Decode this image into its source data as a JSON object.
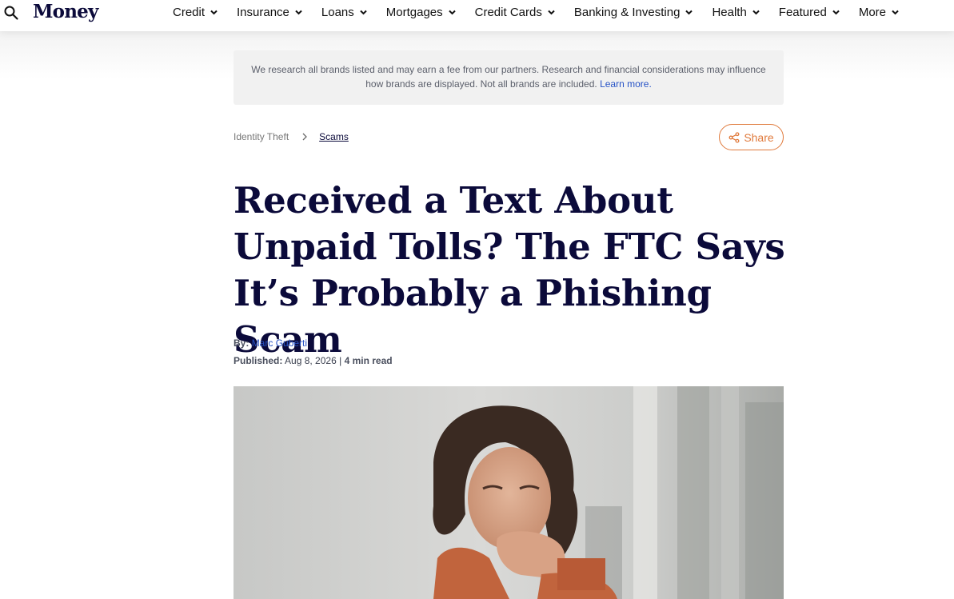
{
  "header": {
    "logo": "Money",
    "nav": [
      {
        "label": "Credit"
      },
      {
        "label": "Insurance"
      },
      {
        "label": "Loans"
      },
      {
        "label": "Mortgages"
      },
      {
        "label": "Credit Cards"
      },
      {
        "label": "Banking & Investing"
      },
      {
        "label": "Health"
      },
      {
        "label": "Featured"
      },
      {
        "label": "More"
      }
    ]
  },
  "disclosure": {
    "text": "We research all brands listed and may earn a fee from our partners. Research and financial considerations may influence how brands are displayed. Not all brands are included.",
    "link": "Learn more."
  },
  "breadcrumb": {
    "parent": "Identity Theft",
    "current": "Scams"
  },
  "share": {
    "label": "Share"
  },
  "article": {
    "title": "Received a Text About Unpaid Tolls? The FTC Says It’s Probably a Phishing Scam",
    "by_label": "By:",
    "author": "Marc Guberti",
    "published_label": "Published:",
    "date": "Aug 8, 2026",
    "separator": "|",
    "read_time": "4 min read"
  },
  "colors": {
    "brand_navy": "#0b0a3a",
    "accent_orange": "#e07a3c",
    "link_blue": "#2753c6"
  }
}
